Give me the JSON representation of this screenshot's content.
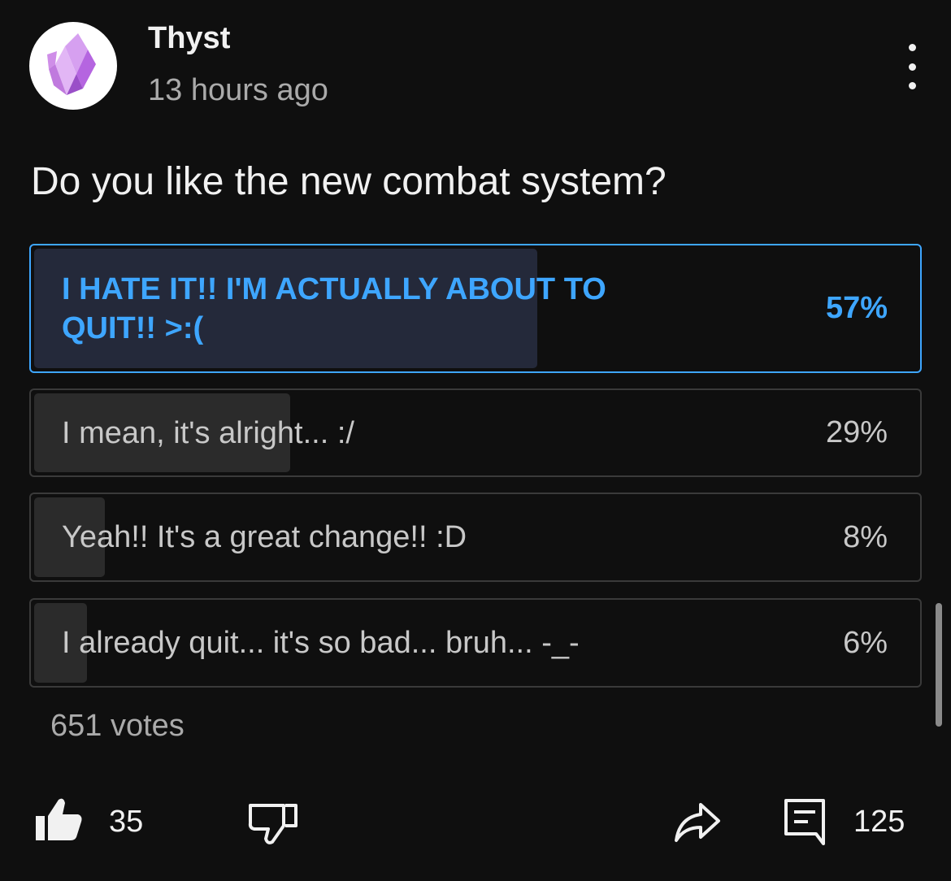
{
  "post": {
    "channel_name": "Thyst",
    "timestamp": "13 hours ago",
    "avatar_icon": "purple-crystal-icon"
  },
  "poll": {
    "question": "Do you like the new combat system?",
    "options": [
      {
        "label": "I HATE IT!! I'M ACTUALLY ABOUT TO QUIT!! >:(",
        "percent_text": "57%",
        "percent": 57,
        "selected": true
      },
      {
        "label": "I mean, it's alright... :/",
        "percent_text": "29%",
        "percent": 29,
        "selected": false
      },
      {
        "label": "Yeah!! It's a great change!! :D",
        "percent_text": "8%",
        "percent": 8,
        "selected": false
      },
      {
        "label": "I already quit... it's so bad... bruh... -_-",
        "percent_text": "6%",
        "percent": 6,
        "selected": false
      }
    ],
    "votes": "651 votes"
  },
  "actions": {
    "like_count": "35",
    "comment_count": "125",
    "icons": [
      "thumbs-up-icon",
      "thumbs-down-icon",
      "share-icon",
      "comment-icon",
      "more-vertical-icon"
    ]
  },
  "colors": {
    "background": "#0f0f0f",
    "accent": "#3ea6ff",
    "selected_fill": "#24293a",
    "option_fill": "#2b2b2b",
    "border": "#3a3a3a"
  }
}
